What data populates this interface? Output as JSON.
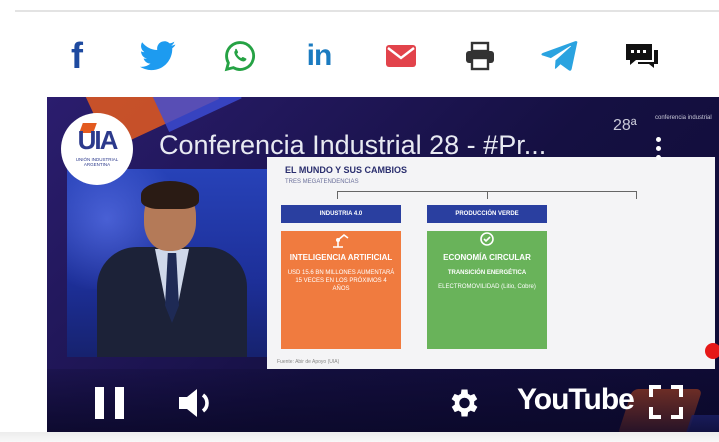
{
  "share_bar": {
    "facebook": {
      "label": "f",
      "icon": "facebook-icon",
      "color": "#1e4aa0"
    },
    "twitter": {
      "icon": "twitter-icon",
      "color": "#1d9bf0"
    },
    "whatsapp": {
      "icon": "whatsapp-icon",
      "color": "#25a244"
    },
    "linkedin": {
      "label": "in",
      "icon": "linkedin-icon",
      "color": "#1b7bc0"
    },
    "email": {
      "icon": "mail-icon",
      "color": "#e2434b"
    },
    "print": {
      "icon": "printer-icon",
      "color": "#333333"
    },
    "telegram": {
      "icon": "telegram-icon",
      "color": "#2aa3e0"
    },
    "comments": {
      "icon": "comment-icon",
      "color": "#111111"
    }
  },
  "video": {
    "title": "Conferencia Industrial 28 - #Pr...",
    "channel_logo": {
      "text": "UIA",
      "subtitle": "UNIÓN INDUSTRIAL ARGENTINA"
    },
    "brand_badge": {
      "number": "28ª",
      "text": "conferencia industrial"
    },
    "slide": {
      "title": "EL MUNDO Y SUS CAMBIOS",
      "subtitle": "TRES MEGATENDENCIAS",
      "cards": [
        {
          "header": "INDUSTRIA 4.0",
          "big": "INTELIGENCIA ARTIFICIAL",
          "small": "USD 15.6 BN MILLONES AUMENTARÁ 15 VECES EN LOS PRÓXIMOS 4 AÑOS",
          "color": "#f07b3f"
        },
        {
          "header": "PRODUCCIÓN VERDE",
          "big": "ECONOMÍA CIRCULAR",
          "mid": "TRANSICIÓN ENERGÉTICA",
          "small": "ELECTROMOVILIDAD (Litio, Cobre)",
          "color": "#69b35a"
        }
      ],
      "footer": "Fuente: Abir de Apoyo (UIA)"
    },
    "controls": {
      "pause": "pause-icon",
      "volume": "volume-icon",
      "settings": "gear-icon",
      "youtube_label": "YouTube",
      "fullscreen": "fullscreen-icon"
    }
  }
}
